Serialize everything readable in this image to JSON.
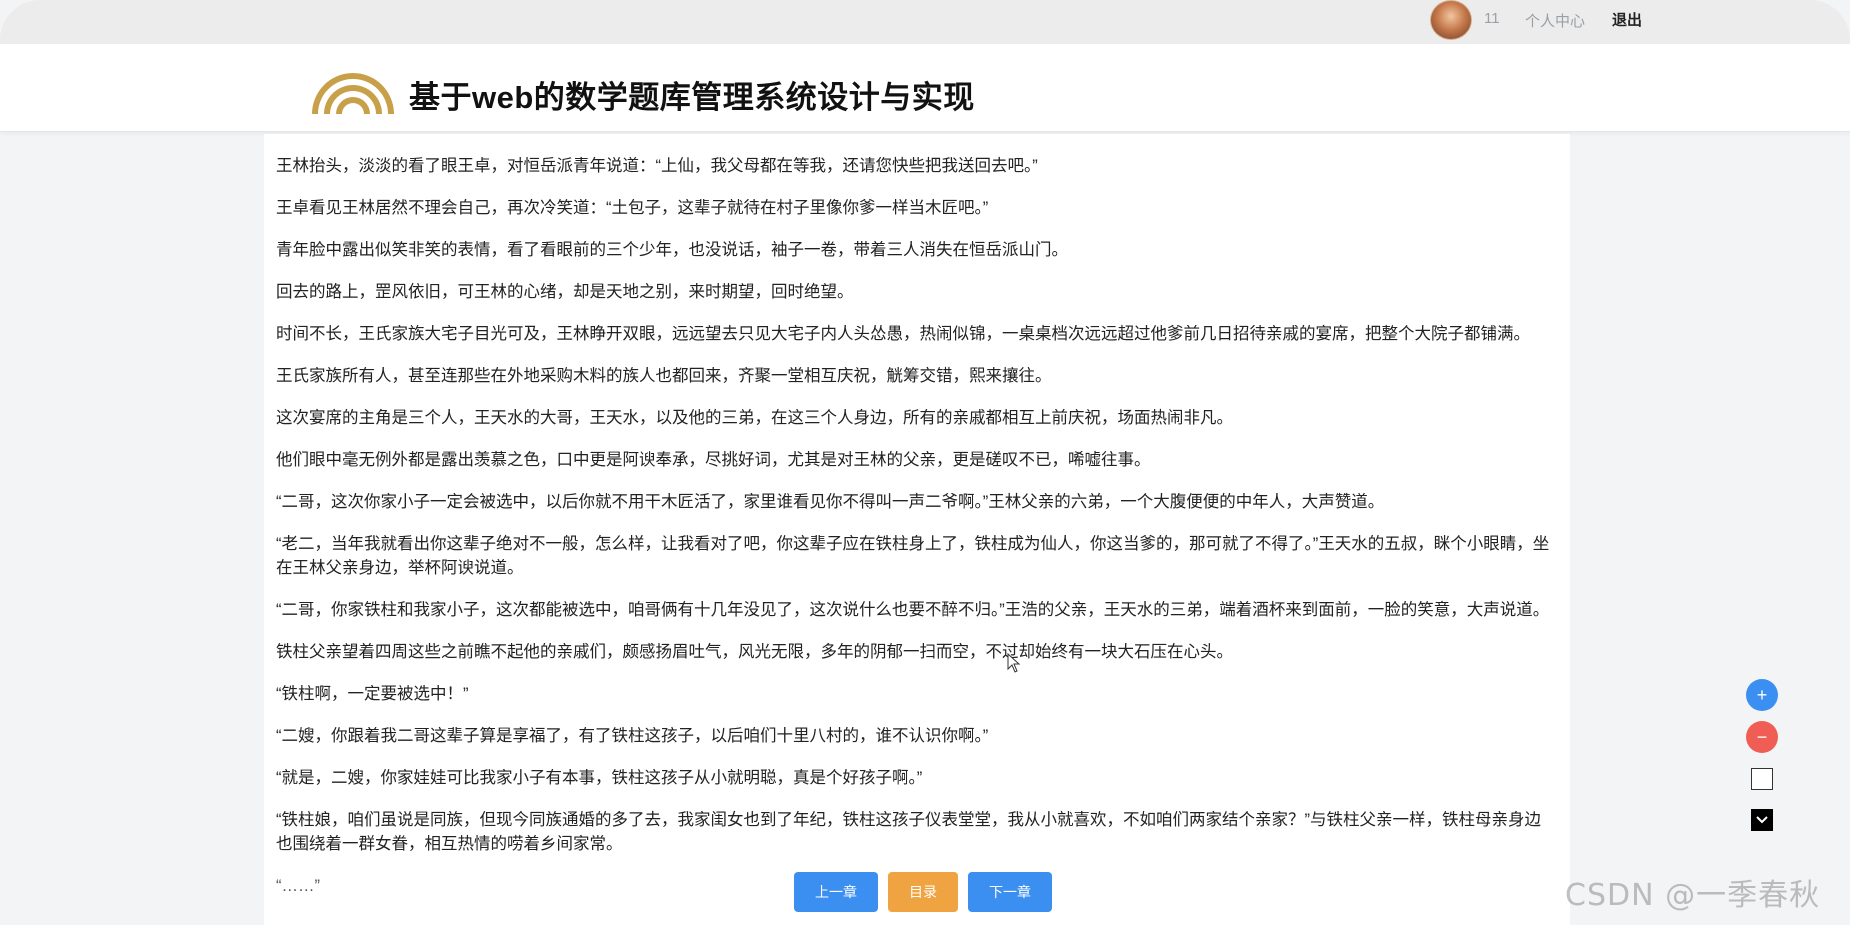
{
  "topbar": {
    "user_id": "11",
    "profile_link": "个人中心",
    "logout_link": "退出"
  },
  "header": {
    "site_title": "基于web的数学题库管理系统设计与实现",
    "logo_color": "#c9a04a"
  },
  "chapter": {
    "paragraphs": [
      "王林抬头，淡淡的看了眼王卓，对恒岳派青年说道：“上仙，我父母都在等我，还请您快些把我送回去吧。”",
      "王卓看见王林居然不理会自己，再次冷笑道：“土包子，这辈子就待在村子里像你爹一样当木匠吧。”",
      "青年脸中露出似笑非笑的表情，看了看眼前的三个少年，也没说话，袖子一卷，带着三人消失在恒岳派山门。",
      "回去的路上，罡风依旧，可王林的心绪，却是天地之别，来时期望，回时绝望。",
      "时间不长，王氏家族大宅子目光可及，王林睁开双眼，远远望去只见大宅子内人头怂愚，热闹似锦，一桌桌档次远远超过他爹前几日招待亲戚的宴席，把整个大院子都铺满。",
      "王氏家族所有人，甚至连那些在外地采购木料的族人也都回来，齐聚一堂相互庆祝，觥筹交错，熙来攘往。",
      "这次宴席的主角是三个人，王天水的大哥，王天水，以及他的三弟，在这三个人身边，所有的亲戚都相互上前庆祝，场面热闹非凡。",
      "他们眼中毫无例外都是露出羡慕之色，口中更是阿谀奉承，尽挑好词，尤其是对王林的父亲，更是磋叹不已，唏嘘往事。",
      "“二哥，这次你家小子一定会被选中，以后你就不用干木匠活了，家里谁看见你不得叫一声二爷啊。”王林父亲的六弟，一个大腹便便的中年人，大声赞道。",
      "“老二，当年我就看出你这辈子绝对不一般，怎么样，让我看对了吧，你这辈子应在铁柱身上了，铁柱成为仙人，你这当爹的，那可就了不得了。”王天水的五叔，眯个小眼睛，坐在王林父亲身边，举杯阿谀说道。",
      "“二哥，你家铁柱和我家小子，这次都能被选中，咱哥俩有十几年没见了，这次说什么也要不醉不归。”王浩的父亲，王天水的三弟，端着酒杯来到面前，一脸的笑意，大声说道。",
      "铁柱父亲望着四周这些之前瞧不起他的亲戚们，颇感扬眉吐气，风光无限，多年的阴郁一扫而空，不过却始终有一块大石压在心头。",
      "“铁柱啊，一定要被选中！”",
      "“二嫂，你跟着我二哥这辈子算是享福了，有了铁柱这孩子，以后咱们十里八村的，谁不认识你啊。”",
      "“就是，二嫂，你家娃娃可比我家小子有本事，铁柱这孩子从小就明聪，真是个好孩子啊。”",
      "“铁柱娘，咱们虽说是同族，但现今同族通婚的多了去，我家闺女也到了年纪，铁柱这孩子仪表堂堂，我从小就喜欢，不如咱们两家结个亲家？”与铁柱父亲一样，铁柱母亲身边也围绕着一群女眷，相互热情的唠着乡间家常。",
      "“……”"
    ]
  },
  "side_tools": {
    "zoom_in": "+",
    "zoom_out": "−"
  },
  "nav": {
    "prev": "上一章",
    "toc": "目录",
    "next": "下一章"
  },
  "watermark": "CSDN @一季春秋",
  "colors": {
    "primary": "#3b8ff0",
    "danger": "#f05d55",
    "warning": "#f0a441"
  }
}
